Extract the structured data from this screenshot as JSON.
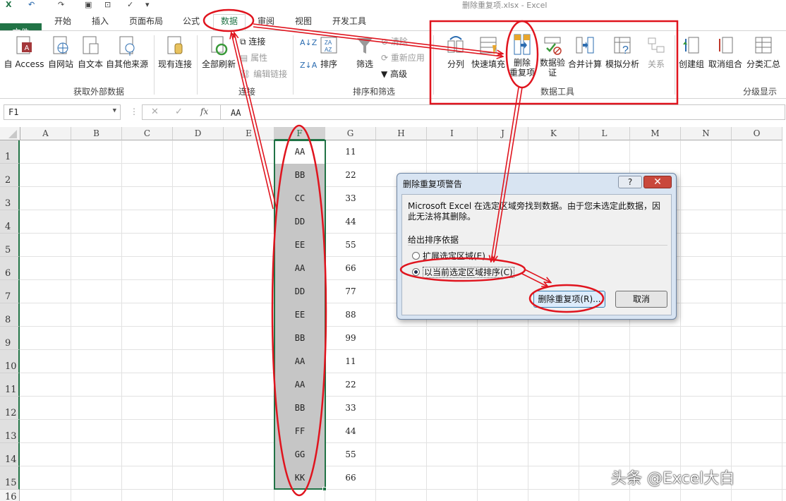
{
  "window": {
    "title": "删除重复项.xlsx - Excel"
  },
  "tabs": [
    {
      "label": "开始"
    },
    {
      "label": "插入"
    },
    {
      "label": "页面布局"
    },
    {
      "label": "公式"
    },
    {
      "label": "数据"
    },
    {
      "label": "审阅"
    },
    {
      "label": "视图"
    },
    {
      "label": "开发工具"
    }
  ],
  "file_tab": "文件",
  "ribbon": {
    "external": {
      "access": "自 Access",
      "web": "自网站",
      "text": "自文本",
      "other": "自其他来源",
      "existing": "现有连接",
      "group": "获取外部数据"
    },
    "connections": {
      "refresh_all": "全部刷新",
      "connections": "连接",
      "properties": "属性",
      "edit_links": "编辑链接",
      "group": "连接"
    },
    "sort_filter": {
      "sort": "排序",
      "filter": "筛选",
      "clear": "清除",
      "reapply": "重新应用",
      "advanced": "高级",
      "group": "排序和筛选"
    },
    "data_tools": {
      "text_to_columns": "分列",
      "flash_fill": "快速填充",
      "remove_dup_1": "删除",
      "remove_dup_2": "重复项",
      "validation_1": "数据验",
      "validation_2": "证",
      "consolidate": "合并计算",
      "what_if": "模拟分析",
      "relationships": "关系",
      "group": "数据工具"
    },
    "outline": {
      "group_btn": "创建组",
      "ungroup": "取消组合",
      "subtotal": "分类汇总",
      "group": "分级显示"
    }
  },
  "formula_bar": {
    "name_box": "F1",
    "formula": "AA",
    "fx": "fx"
  },
  "sheet": {
    "columns": [
      "A",
      "B",
      "C",
      "D",
      "E",
      "F",
      "G",
      "H",
      "I",
      "J",
      "K",
      "L",
      "M",
      "N",
      "O"
    ],
    "rows": [
      "1",
      "2",
      "3",
      "4",
      "5",
      "6",
      "7",
      "8",
      "9",
      "10",
      "11",
      "12",
      "13",
      "14",
      "15",
      "16"
    ],
    "col_f": [
      "AA",
      "BB",
      "CC",
      "DD",
      "EE",
      "AA",
      "DD",
      "EE",
      "BB",
      "AA",
      "AA",
      "BB",
      "FF",
      "GG",
      "KK"
    ],
    "col_g": [
      "11",
      "22",
      "33",
      "44",
      "55",
      "66",
      "77",
      "88",
      "99",
      "11",
      "22",
      "33",
      "44",
      "55",
      "66"
    ]
  },
  "dialog": {
    "title": "删除重复项警告",
    "help": "?",
    "close": "✕",
    "message": "Microsoft Excel 在选定区域旁找到数据。由于您未选定此数据，因此无法将其删除。",
    "group_label": "给出排序依据",
    "option_expand": "扩展选定区域(E)",
    "option_current": "以当前选定区域排序(C)",
    "btn_remove": "删除重复项(R)...",
    "btn_cancel": "取消"
  },
  "watermark": "头条 @Excel大白",
  "colors": {
    "excel_green": "#217346",
    "annotation_red": "#e0141e",
    "selection_gray": "#c6c6c6"
  }
}
